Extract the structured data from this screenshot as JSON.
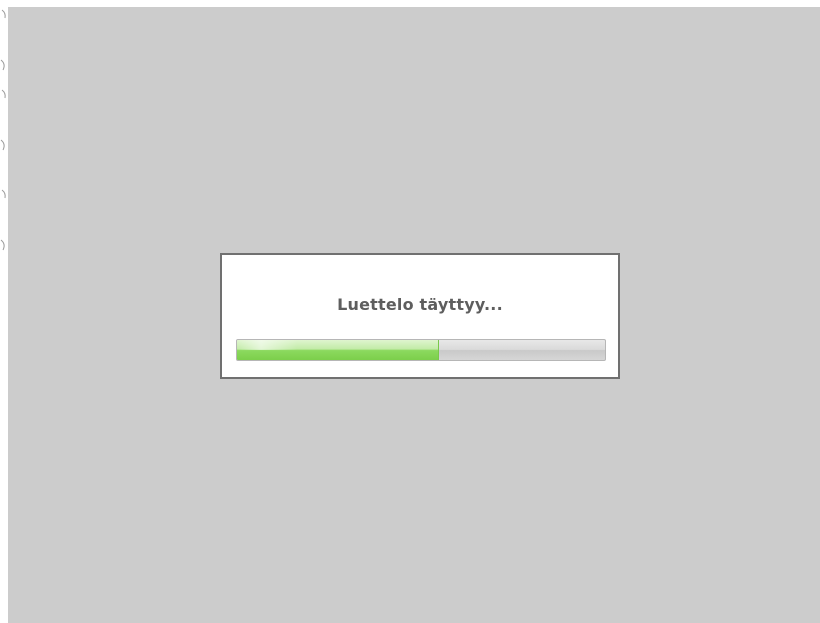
{
  "dialog": {
    "message": "Luettelo täyttyy..."
  },
  "progress": {
    "value": 0.55
  },
  "colors": {
    "overlay": "#cccccc",
    "dialog_border": "#707070",
    "progress_fill": "#8cd95f",
    "progress_track": "#d6d6d6",
    "text": "#5e5e5e"
  }
}
